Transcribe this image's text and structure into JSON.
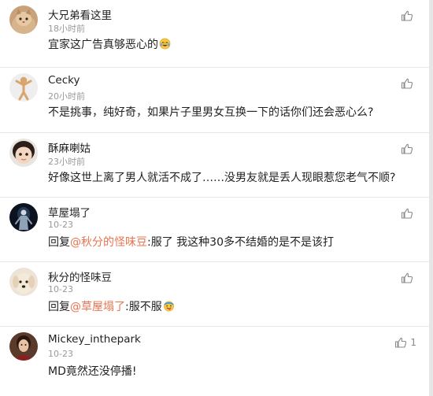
{
  "comments": [
    {
      "name": "大兄弟看这里",
      "time": "18小时前",
      "text": "宜家这广告真够恶心的",
      "emoji": "crying-laughing-emoji",
      "avatar": "cat-avatar",
      "like_count": ""
    },
    {
      "name": "Cecky",
      "time": "20小时前",
      "text": "不是挑事，纯好奇，如果片子里男女互换一下的话你们还会恶心么?",
      "avatar": "figure-avatar",
      "like_count": ""
    },
    {
      "name": "酥麻喇姑",
      "time": "23小时前",
      "text": "好像这世上离了男人就活不成了……没男友就是丢人现眼惹您老气不顺?",
      "avatar": "child-avatar",
      "like_count": ""
    },
    {
      "name": "草屋塌了",
      "time": "10-23",
      "reply_prefix": "回复",
      "mention": "@秋分的怪味豆",
      "text": ":服了 我这种30多不结婚的是不是该打",
      "avatar": "dark-figure-avatar",
      "like_count": ""
    },
    {
      "name": "秋分的怪味豆",
      "time": "10-23",
      "reply_prefix": "回复",
      "mention": "@草屋塌了",
      "text": ":服不服",
      "emoji": "tongue-out-emoji",
      "avatar": "dog-avatar",
      "like_count": ""
    },
    {
      "name": "Mickey_inthepark",
      "time": "10-23",
      "text": "MD竟然还没停播!",
      "avatar": "person-avatar",
      "like_count": "1"
    }
  ]
}
